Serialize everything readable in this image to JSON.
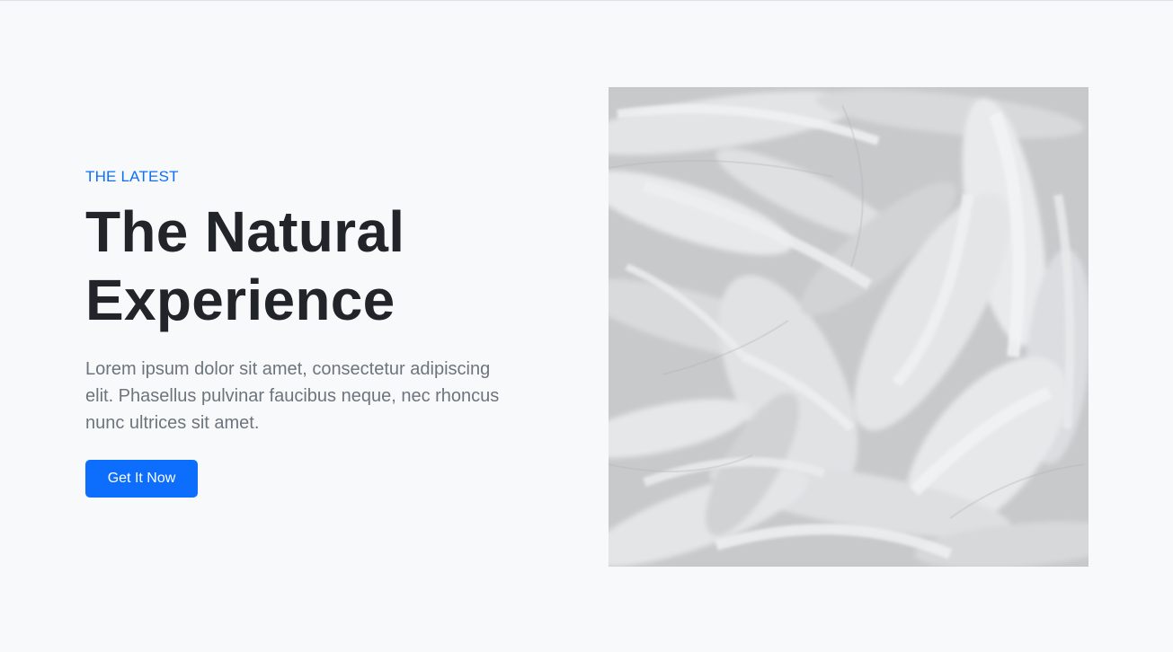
{
  "hero": {
    "eyebrow": "THE LATEST",
    "headline_line1": "The Natural",
    "headline_line2": "Experience",
    "lead": "Lorem ipsum dolor sit amet, consectetur adipiscing elit. Phasellus pulvinar faucibus neque, nec rhoncus nunc ultrices sit amet.",
    "cta_label": "Get It Now"
  },
  "image": {
    "subject": "white-paint-brush-strokes",
    "palette": [
      "#c9cacc",
      "#dcdde0",
      "#eeeff1",
      "#b4b5b8"
    ]
  },
  "colors": {
    "accent": "#0d6efd",
    "heading": "#212529",
    "muted": "#6c757d",
    "background": "#f8f9fa"
  }
}
